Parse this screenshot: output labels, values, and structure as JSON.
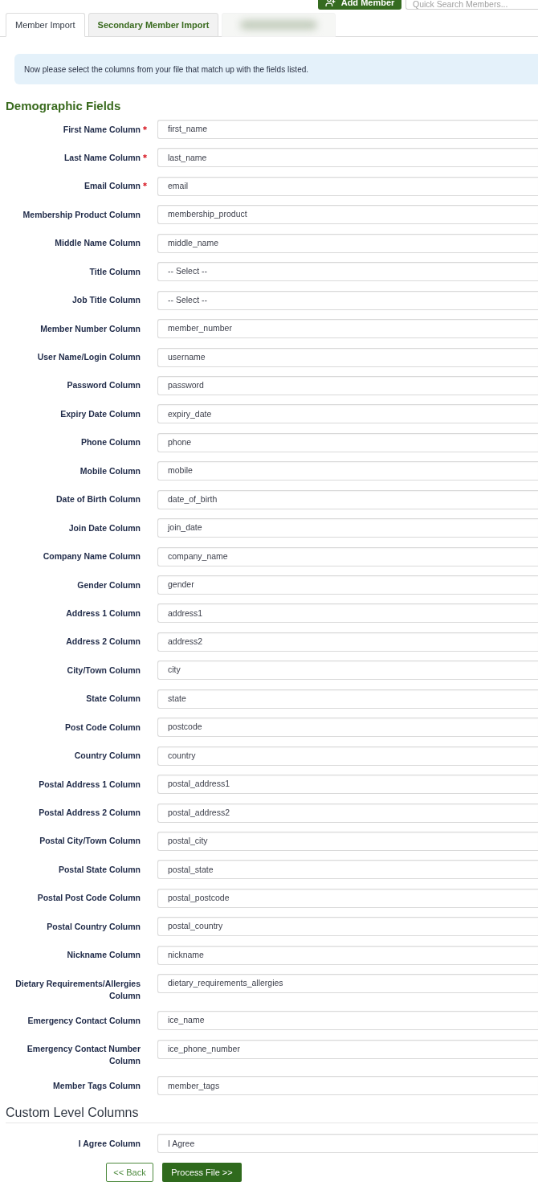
{
  "header": {
    "add_button": "Add Member",
    "search": {
      "placeholder": "Quick Search Members..."
    }
  },
  "tabs": [
    {
      "kind": "text",
      "label": "Member Import",
      "selected": true
    },
    {
      "kind": "text",
      "label": "Secondary Member Import",
      "selected": false
    },
    {
      "kind": "blurred",
      "selected": false
    }
  ],
  "alert": {
    "message": "Now please select the columns from your file that match up with the fields listed."
  },
  "demographic_fields": {
    "heading": "Demographic Fields",
    "fields": [
      {
        "label": "First Name Column",
        "required": true,
        "value": "first_name"
      },
      {
        "label": "Last Name Column",
        "required": true,
        "value": "last_name"
      },
      {
        "label": "Email Column",
        "required": true,
        "value": "email"
      },
      {
        "label": "Membership Product Column",
        "required": false,
        "value": "membership_product"
      },
      {
        "label": "Middle Name Column",
        "required": false,
        "value": "middle_name"
      },
      {
        "label": "Title Column",
        "required": false,
        "value": "-- Select --"
      },
      {
        "label": "Job Title Column",
        "required": false,
        "value": "-- Select --"
      },
      {
        "label": "Member Number Column",
        "required": false,
        "value": "member_number"
      },
      {
        "label": "User Name/Login Column",
        "required": false,
        "value": "username"
      },
      {
        "label": "Password Column",
        "required": false,
        "value": "password"
      },
      {
        "label": "Expiry Date Column",
        "required": false,
        "value": "expiry_date"
      },
      {
        "label": "Phone Column",
        "required": false,
        "value": "phone"
      },
      {
        "label": "Mobile Column",
        "required": false,
        "value": "mobile"
      },
      {
        "label": "Date of Birth Column",
        "required": false,
        "value": "date_of_birth"
      },
      {
        "label": "Join Date Column",
        "required": false,
        "value": "join_date"
      },
      {
        "label": "Company Name Column",
        "required": false,
        "value": "company_name"
      },
      {
        "label": "Gender Column",
        "required": false,
        "value": "gender"
      },
      {
        "label": "Address 1 Column",
        "required": false,
        "value": "address1"
      },
      {
        "label": "Address 2 Column",
        "required": false,
        "value": "address2"
      },
      {
        "label": "City/Town Column",
        "required": false,
        "value": "city"
      },
      {
        "label": "State Column",
        "required": false,
        "value": "state"
      },
      {
        "label": "Post Code Column",
        "required": false,
        "value": "postcode"
      },
      {
        "label": "Country Column",
        "required": false,
        "value": "country"
      },
      {
        "label": "Postal Address 1 Column",
        "required": false,
        "value": "postal_address1"
      },
      {
        "label": "Postal Address 2 Column",
        "required": false,
        "value": "postal_address2"
      },
      {
        "label": "Postal City/Town Column",
        "required": false,
        "value": "postal_city"
      },
      {
        "label": "Postal State Column",
        "required": false,
        "value": "postal_state"
      },
      {
        "label": "Postal Post Code Column",
        "required": false,
        "value": "postal_postcode"
      },
      {
        "label": "Postal Country Column",
        "required": false,
        "value": "postal_country"
      },
      {
        "label": "Nickname Column",
        "required": false,
        "value": "nickname"
      },
      {
        "label": "Dietary Requirements/Allergies Column",
        "required": false,
        "value": "dietary_requirements_allergies"
      },
      {
        "label": "Emergency Contact Column",
        "required": false,
        "value": "ice_name"
      },
      {
        "label": "Emergency Contact Number Column",
        "required": false,
        "value": "ice_phone_number"
      },
      {
        "label": "Member Tags Column",
        "required": false,
        "value": "member_tags"
      }
    ]
  },
  "custom_level_columns": {
    "heading": "Custom Level Columns",
    "fields": [
      {
        "label": "I Agree Column",
        "required": false,
        "value": "I Agree"
      }
    ]
  },
  "buttons": [
    {
      "kind": "secondary",
      "label": "<< Back"
    },
    {
      "kind": "primary",
      "label": "Process File >>"
    }
  ]
}
